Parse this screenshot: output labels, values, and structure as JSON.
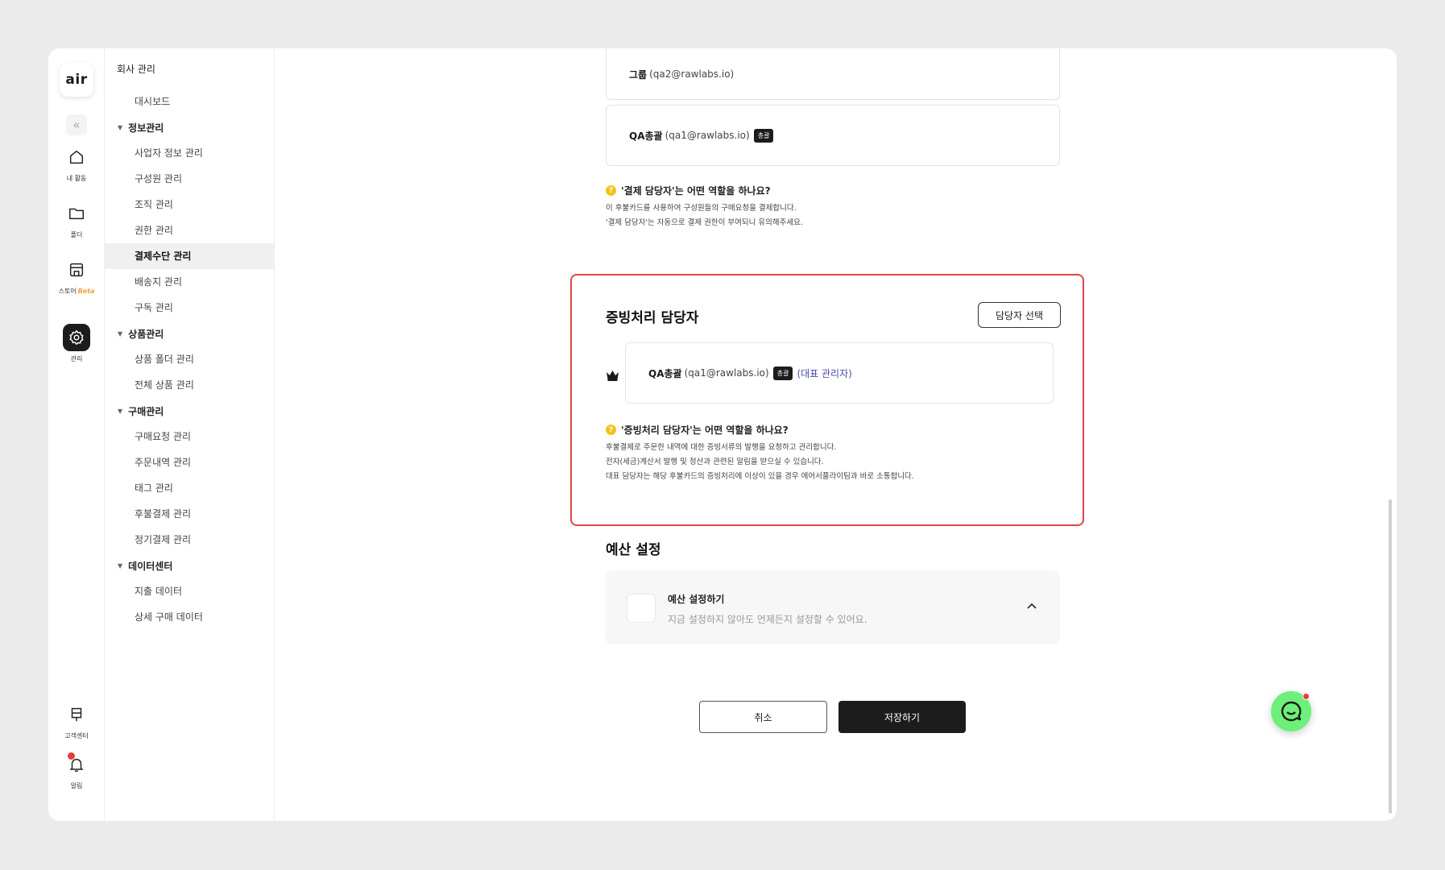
{
  "rail": {
    "logo": "air",
    "collapse_icon": "double-chevron-left",
    "items": [
      {
        "label": "내 활동",
        "icon": "home-icon"
      },
      {
        "label": "폴더",
        "icon": "folder-icon"
      },
      {
        "label": "스토어",
        "beta": "Beta",
        "icon": "store-icon"
      },
      {
        "label": "관리",
        "icon": "gear-icon",
        "active": true
      },
      {
        "label": "고객센터",
        "icon": "signpost-icon"
      },
      {
        "label": "알림",
        "icon": "bell-icon"
      }
    ]
  },
  "sidebar": {
    "header": "회사 관리",
    "dashboard": "대시보드",
    "groups": [
      {
        "label": "정보관리",
        "items": [
          "사업자 정보 관리",
          "구성원 관리",
          "조직 관리",
          "권한 관리",
          "결제수단 관리",
          "배송지 관리",
          "구독 관리"
        ]
      },
      {
        "label": "상품관리",
        "items": [
          "상품 폴더 관리",
          "전체 상품 관리"
        ]
      },
      {
        "label": "구매관리",
        "items": [
          "구매요청 관리",
          "주문내역 관리",
          "태그 관리",
          "후불결제 관리",
          "정기결제 관리"
        ]
      },
      {
        "label": "데이터센터",
        "items": [
          "지출 데이터",
          "상세 구매 데이터"
        ]
      }
    ],
    "active_item": "결제수단 관리"
  },
  "payment_section": {
    "card1": {
      "name": "그룹",
      "email": "(qa2@rawlabs.io)"
    },
    "card2": {
      "name": "QA총괄",
      "email": "(qa1@rawlabs.io)",
      "badge": "총괄"
    },
    "question": "'결제 담당자'는 어떤 역할을 하나요?",
    "desc1": "이 후불카드를 사용하여 구성원들의 구매요청을 결제합니다.",
    "desc2": "'결제 담당자'는 자동으로 결제 권한이 부여되니 유의해주세요."
  },
  "evidence_section": {
    "title": "증빙처리 담당자",
    "select_button": "담당자 선택",
    "card": {
      "name": "QA총괄",
      "email": "(qa1@rawlabs.io)",
      "badge": "총괄",
      "rep": "(대표 관리자)"
    },
    "question": "'증빙처리 담당자'는 어떤 역할을 하나요?",
    "desc1": "후불결제로 주문한 내역에 대한 증빙서류의 발행을 요청하고 관리합니다.",
    "desc2": "전자(세금)계산서 발행 및 정산과 관련된 알림을 받으실 수 있습니다.",
    "desc3": "대표 담당자는 해당 후불카드의 증빙처리에 이상이 있을 경우 에어서플라이팀과 바로 소통합니다."
  },
  "budget_section": {
    "title": "예산 설정",
    "toggle_label": "예산 설정하기",
    "toggle_desc": "지금 설정하지 않아도 언제든지 설정할 수 있어요."
  },
  "actions": {
    "cancel": "취소",
    "save": "저장하기"
  },
  "colors": {
    "accent_dark": "#1c1c1c",
    "highlight_border": "#e04545",
    "link": "#4b4aa8",
    "help_icon": "#f6c31c",
    "chat_button": "#6cf079"
  }
}
